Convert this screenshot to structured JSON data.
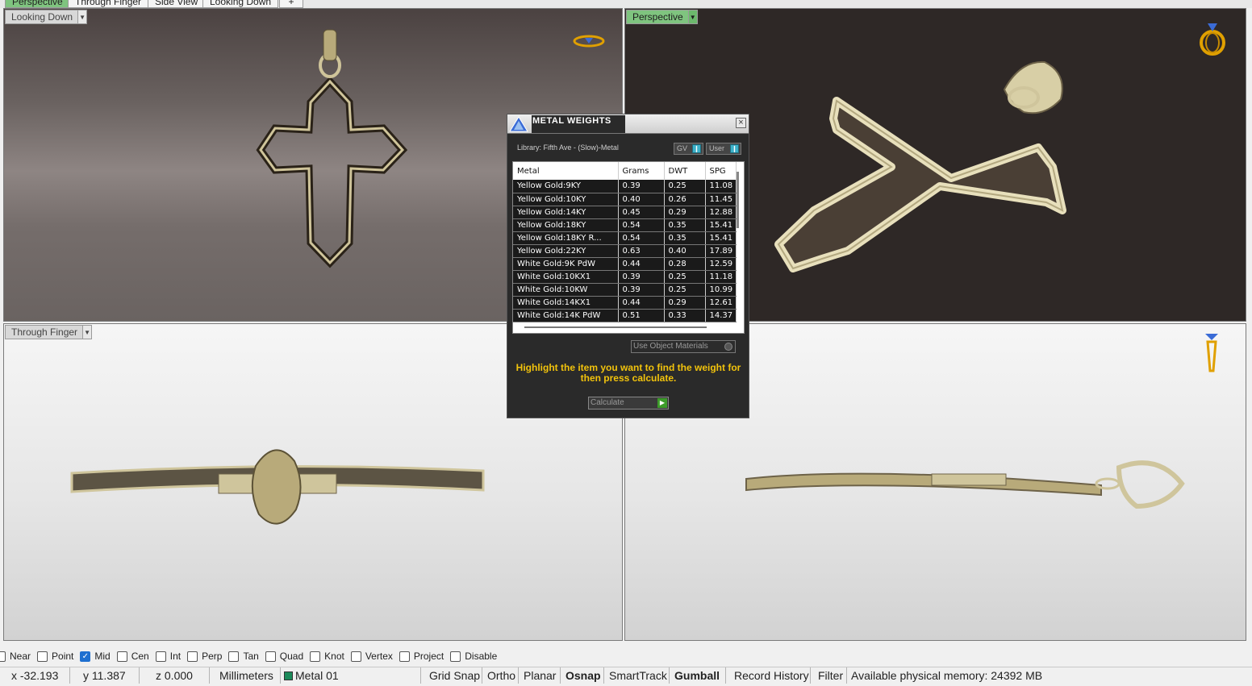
{
  "view_tabs": [
    "Perspective",
    "Through Finger",
    "Side View",
    "Looking Down",
    "+"
  ],
  "viewports": {
    "top_left": "Looking Down",
    "top_right": "Perspective",
    "bottom_left": "Through Finger",
    "bottom_right": ""
  },
  "dialog": {
    "title": "METAL WEIGHTS",
    "library": "Library: Fifth Ave - (Slow)-Metal",
    "gv_label": "GV",
    "user_label": "User",
    "columns": [
      "Metal",
      "Grams",
      "DWT",
      "SPG"
    ],
    "rows": [
      [
        "Yellow Gold:9KY",
        "0.39",
        "0.25",
        "11.08"
      ],
      [
        "Yellow Gold:10KY",
        "0.40",
        "0.26",
        "11.45"
      ],
      [
        "Yellow Gold:14KY",
        "0.45",
        "0.29",
        "12.88"
      ],
      [
        "Yellow Gold:18KY",
        "0.54",
        "0.35",
        "15.41"
      ],
      [
        "Yellow Gold:18KY R...",
        "0.54",
        "0.35",
        "15.41"
      ],
      [
        "Yellow Gold:22KY",
        "0.63",
        "0.40",
        "17.89"
      ],
      [
        "White Gold:9K PdW",
        "0.44",
        "0.28",
        "12.59"
      ],
      [
        "White Gold:10KX1",
        "0.39",
        "0.25",
        "11.18"
      ],
      [
        "White Gold:10KW",
        "0.39",
        "0.25",
        "10.99"
      ],
      [
        "White Gold:14KX1",
        "0.44",
        "0.29",
        "12.61"
      ],
      [
        "White Gold:14K PdW",
        "0.51",
        "0.33",
        "14.37"
      ]
    ],
    "use_object_materials": "Use Object Materials",
    "hint": "Highlight the item you want to find the weight for then press calculate.",
    "calculate": "Calculate"
  },
  "osnap": [
    {
      "label": "Near",
      "checked": false
    },
    {
      "label": "Point",
      "checked": false
    },
    {
      "label": "Mid",
      "checked": true
    },
    {
      "label": "Cen",
      "checked": false
    },
    {
      "label": "Int",
      "checked": false
    },
    {
      "label": "Perp",
      "checked": false
    },
    {
      "label": "Tan",
      "checked": false
    },
    {
      "label": "Quad",
      "checked": false
    },
    {
      "label": "Knot",
      "checked": false
    },
    {
      "label": "Vertex",
      "checked": false
    },
    {
      "label": "Project",
      "checked": false
    },
    {
      "label": "Disable",
      "checked": false
    }
  ],
  "status": {
    "x": "x -32.193",
    "y": "y 11.387",
    "z": "z 0.000",
    "units": "Millimeters",
    "layer": "Metal 01",
    "layer_color": "#1b8a5a",
    "grid_snap": "Grid Snap",
    "ortho": "Ortho",
    "planar": "Planar",
    "osnap": "Osnap",
    "smarttrack": "SmartTrack",
    "gumball": "Gumball",
    "record_history": "Record History",
    "filter": "Filter",
    "memory": "Available physical memory: 24392 MB"
  },
  "colors": {
    "active_tab": "#7fc47f",
    "gold": "#e6ddb0",
    "hint_text": "#f2c30c"
  }
}
